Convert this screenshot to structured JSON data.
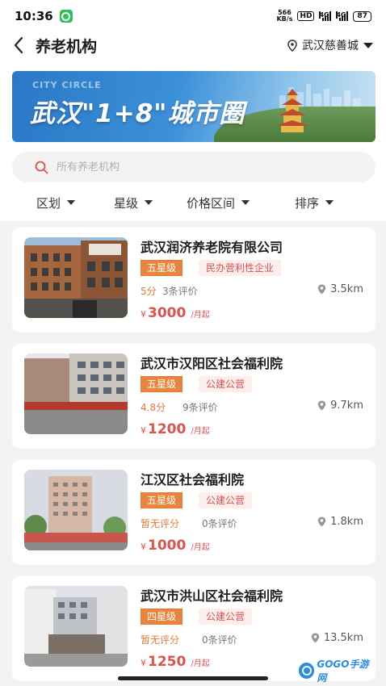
{
  "status_bar": {
    "time": "10:36",
    "net_speed_value": "566",
    "net_speed_unit": "KB/s",
    "hd": "HD",
    "signal1": "4G",
    "signal2": "4G",
    "battery": "87"
  },
  "header": {
    "title": "养老机构",
    "location": "武汉慈善城"
  },
  "banner": {
    "tag": "CITY CIRCLE",
    "title": "武汉\"1+8\"城市圈"
  },
  "search": {
    "placeholder": "所有养老机构"
  },
  "filters": [
    {
      "label": "区划"
    },
    {
      "label": "星级"
    },
    {
      "label": "价格区间"
    },
    {
      "label": "排序"
    }
  ],
  "institutions": [
    {
      "name": "武汉润济养老院有限公司",
      "star": "五星级",
      "type": "民办营利性企业",
      "score": "5分",
      "reviews": "3条评价",
      "distance": "3.5km",
      "price_symbol": "¥",
      "price": "3000",
      "price_unit": "/月起"
    },
    {
      "name": "武汉市汉阳区社会福利院",
      "star": "五星级",
      "type": "公建公营",
      "score": "4.8分",
      "reviews": "9条评价",
      "distance": "9.7km",
      "price_symbol": "¥",
      "price": "1200",
      "price_unit": "/月起"
    },
    {
      "name": "江汉区社会福利院",
      "star": "五星级",
      "type": "公建公营",
      "score": "暂无评分",
      "reviews": "0条评价",
      "distance": "1.8km",
      "price_symbol": "¥",
      "price": "1000",
      "price_unit": "/月起"
    },
    {
      "name": "武汉市洪山区社会福利院",
      "star": "四星级",
      "type": "公建公营",
      "score": "暂无评分",
      "reviews": "0条评价",
      "distance": "13.5km",
      "price_symbol": "¥",
      "price": "1250",
      "price_unit": "/月起"
    }
  ],
  "watermark": {
    "text": "GOGO手游网"
  },
  "colors": {
    "accent_orange": "#e9853f",
    "accent_red": "#d9534f",
    "background_gray": "#f3f3f3"
  }
}
